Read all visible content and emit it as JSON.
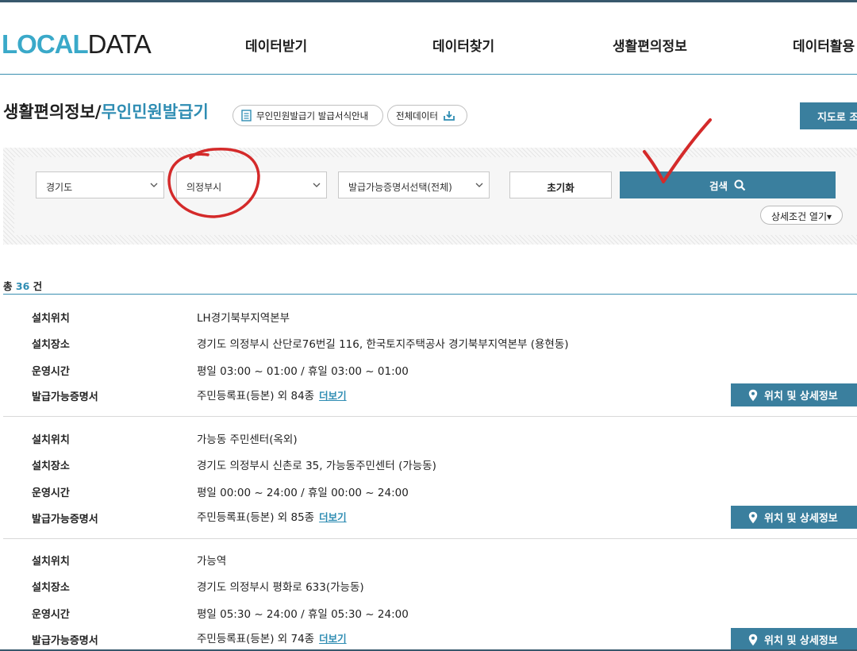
{
  "header": {
    "logo_part1": "LOCAL",
    "logo_part2": "DATA",
    "nav": [
      "데이터받기",
      "데이터찾기",
      "생활편의정보",
      "데이터활용"
    ]
  },
  "title": {
    "main": "생활편의정보",
    "separator": "/",
    "sub": "무인민원발급기",
    "guide_button": "무인민원발급기 발급서식안내",
    "all_data_button": "전체데이터",
    "map_button": "지도로 조회"
  },
  "search": {
    "province": "경기도",
    "city": "의정부시",
    "certificate": "발급가능증명서선택(전체)",
    "reset_label": "초기화",
    "search_label": "검색",
    "detail_label": "상세조건 열기▾"
  },
  "total": {
    "prefix": "총",
    "count": "36",
    "suffix": "건"
  },
  "labels": {
    "location": "설치위치",
    "place": "설치장소",
    "hours": "운영시간",
    "certs": "발급가능증명서",
    "more": "더보기",
    "detail_button": "위치 및 상세정보"
  },
  "results": [
    {
      "location": "LH경기북부지역본부",
      "place": "경기도 의정부시 산단로76번길 116, 한국토지주택공사 경기북부지역본부 (용현동)",
      "hours": "평일 03:00 ~ 01:00 / 휴일 03:00 ~ 01:00",
      "certs": "주민등록표(등본) 외 84종"
    },
    {
      "location": "가능동 주민센터(옥외)",
      "place": "경기도 의정부시 신촌로 35, 가능동주민센터 (가능동)",
      "hours": "평일 00:00 ~ 24:00 / 휴일 00:00 ~ 24:00",
      "certs": "주민등록표(등본) 외 85종"
    },
    {
      "location": "가능역",
      "place": "경기도 의정부시 평화로 633(가능동)",
      "hours": "평일 05:30 ~ 24:00 / 휴일 05:30 ~ 24:00",
      "certs": "주민등록표(등본) 외 74종"
    }
  ],
  "colors": {
    "accent": "#3a7f9e",
    "link": "#2f8db3",
    "annotation": "#d42a2a"
  }
}
